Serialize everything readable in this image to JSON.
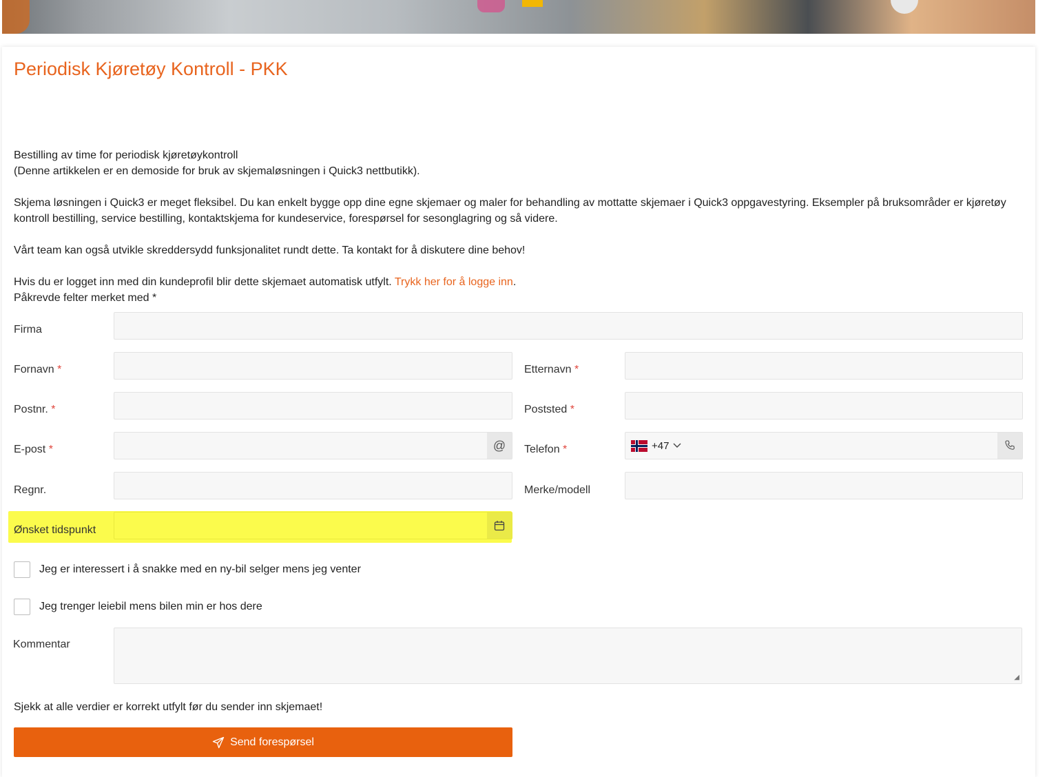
{
  "page": {
    "title": "Periodisk Kjøretøy Kontroll - PKK",
    "intro_line1": "Bestilling av time for periodisk kjøretøykontroll",
    "intro_line2": "(Denne artikkelen er en demoside for bruk av skjemaløsningen i Quick3 nettbutikk).",
    "intro_para2": "Skjema løsningen i Quick3 er meget fleksibel. Du kan enkelt bygge opp dine egne skjemaer og maler for behandling av mottatte skjemaer i Quick3 oppgavestyring. Eksempler på bruksområder er kjøretøy kontroll bestilling, service bestilling, kontaktskjema for kundeservice, forespørsel for sesonglagring og så videre.",
    "intro_para3": "Vårt team kan også utvikle skreddersydd funksjonalitet rundt dette. Ta kontakt for å diskutere dine behov!",
    "login_text": "Hvis du er logget inn med din kundeprofil blir dette skjemaet automatisk utfylt.",
    "login_link": "Trykk her for å logge inn",
    "login_after": ".",
    "required_note": "Påkrevde felter merket med *"
  },
  "form": {
    "required_mark": "*",
    "firma_label": "Firma",
    "fornavn_label": "Fornavn",
    "etternavn_label": "Etternavn",
    "postnr_label": "Postnr.",
    "poststed_label": "Poststed",
    "epost_label": "E-post",
    "telefon_label": "Telefon",
    "phone_prefix": "+47",
    "regnr_label": "Regnr.",
    "merke_label": "Merke/modell",
    "tidspunkt_label": "Ønsket tidspunkt",
    "checkbox1_label": "Jeg er interessert i å snakke med en ny-bil selger mens jeg venter",
    "checkbox2_label": "Jeg trenger leiebil mens bilen min er hos dere",
    "kommentar_label": "Kommentar",
    "check_note": "Sjekk at alle verdier er korrekt utfylt før du sender inn skjemaet!",
    "submit_label": "Send forespørsel"
  },
  "icons": {
    "email": "at-icon",
    "phone": "phone-icon",
    "calendar": "calendar-icon",
    "send": "send-icon",
    "flag": "norway-flag-icon",
    "dropdown": "chevron-down-icon"
  },
  "colors": {
    "accent": "#e8641e",
    "button": "#e8610e",
    "highlight": "#fbfb4c",
    "required": "#e0453c"
  }
}
